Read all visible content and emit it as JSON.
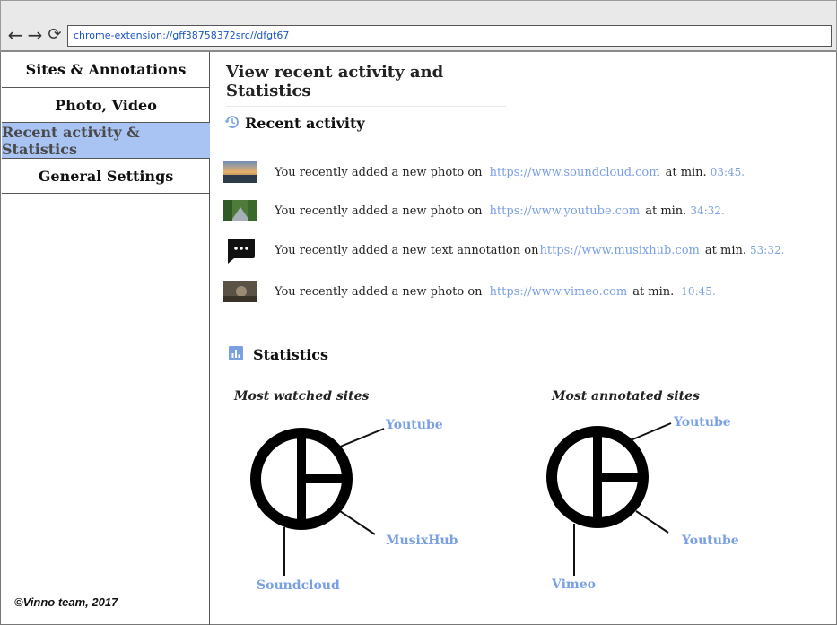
{
  "browser": {
    "url": "chrome-extension://gff38758372src//dfgt67"
  },
  "sidebar": {
    "items": [
      {
        "label": "Sites & Annotations"
      },
      {
        "label": "Photo, Video"
      },
      {
        "label": "Recent activity & Statistics"
      },
      {
        "label": "General Settings"
      }
    ],
    "footer": "©Vinno team, 2017"
  },
  "main": {
    "title": "View recent activity and Statistics",
    "recent": {
      "heading": "Recent activity",
      "items": [
        {
          "text": "You recently added a new photo on",
          "link": "https://www.soundcloud.com",
          "suffix": "at min.",
          "time": "03:45."
        },
        {
          "text": "You recently added a new photo on",
          "link": "https://www.youtube.com",
          "suffix": "at min.",
          "time": "34:32."
        },
        {
          "text": "You recently added a new text annotation on",
          "link": "https://www.musixhub.com",
          "suffix": "at min.",
          "time": "53:32."
        },
        {
          "text": "You recently added a new photo on",
          "link": "https://www.vimeo.com",
          "suffix": "at min.",
          "time": "10:45."
        }
      ]
    },
    "statistics": {
      "heading": "Statistics"
    }
  },
  "chart_data": [
    {
      "type": "pie",
      "title": "Most watched sites",
      "categories": [
        "Youtube",
        "MusixHub",
        "Soundcloud"
      ],
      "values": [
        25,
        25,
        50
      ]
    },
    {
      "type": "pie",
      "title": "Most annotated sites",
      "categories": [
        "Youtube",
        "Youtube",
        "Vimeo"
      ],
      "values": [
        25,
        25,
        50
      ]
    }
  ],
  "colors": {
    "accent": "#7aa0e4",
    "active_tab": "#a9c4f2"
  }
}
